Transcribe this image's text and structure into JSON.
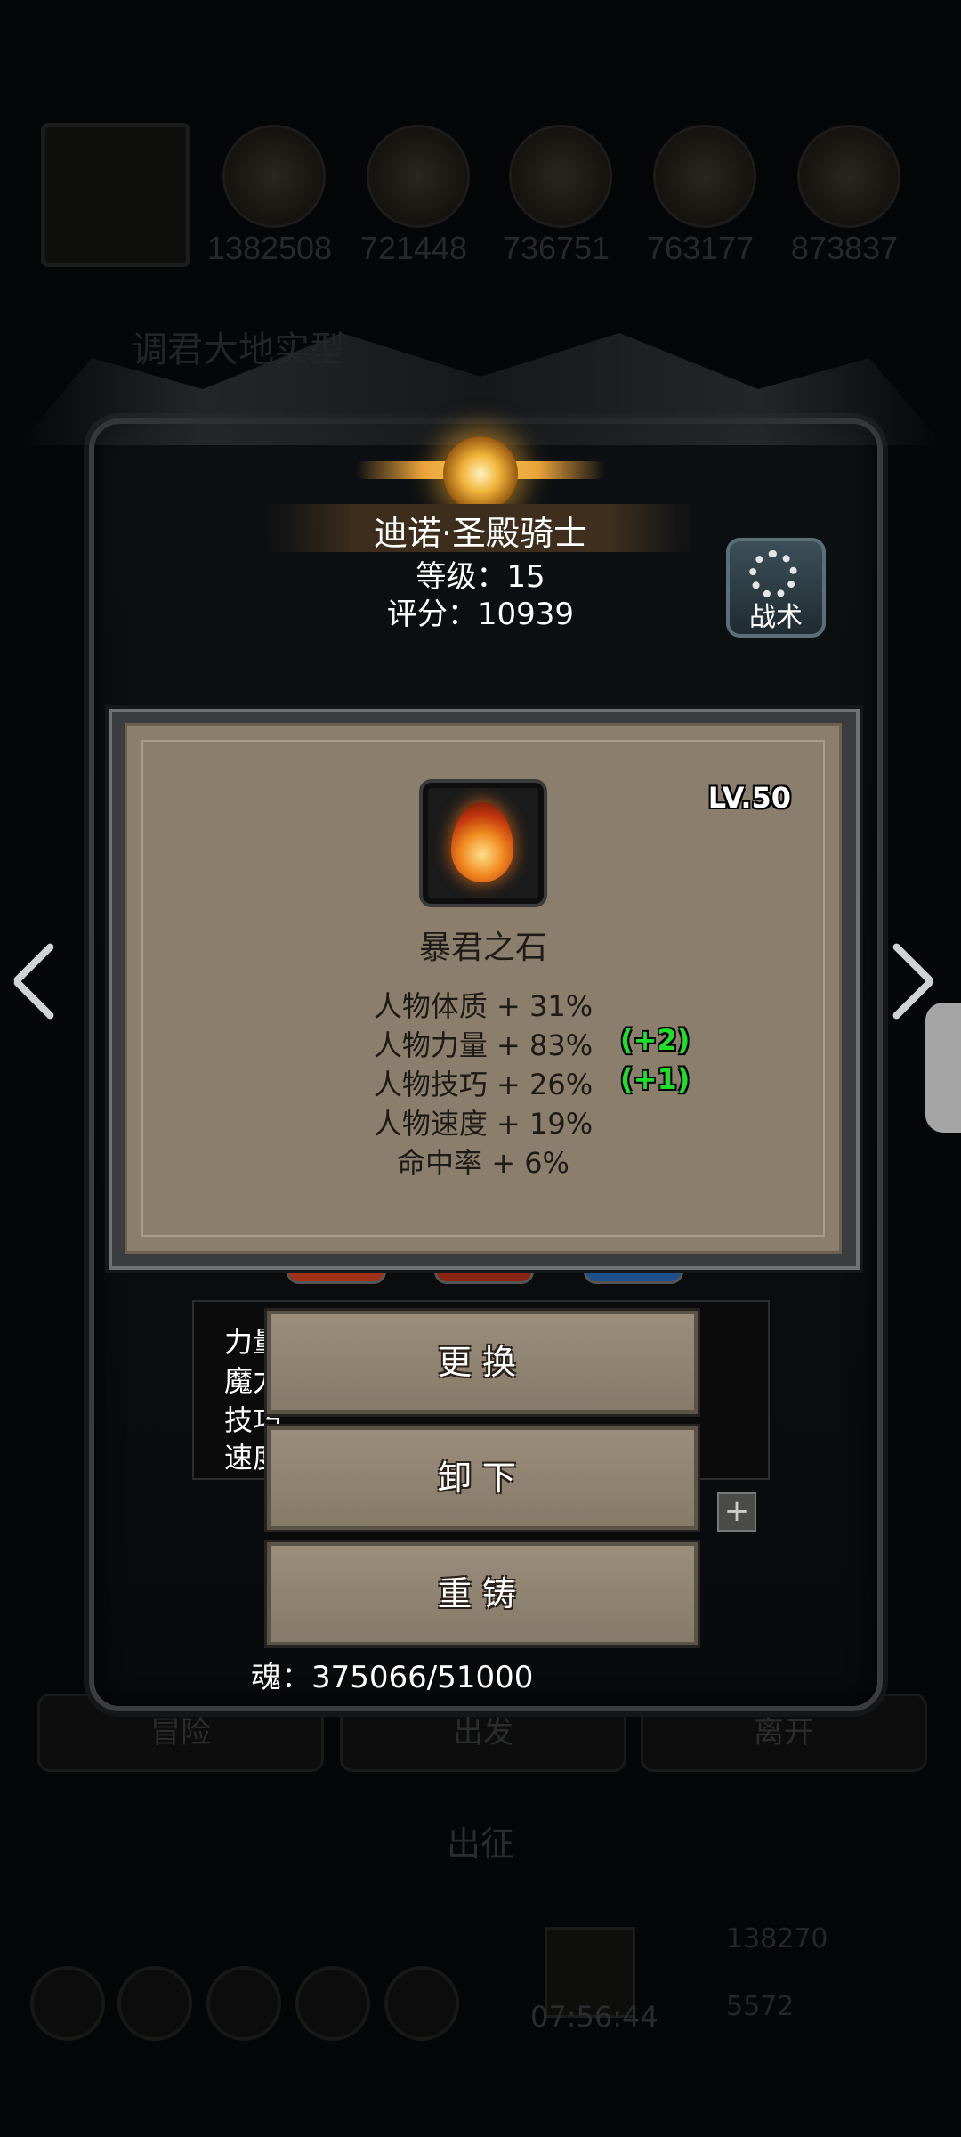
{
  "background": {
    "resources": [
      "1382508",
      "721448",
      "736751",
      "763177",
      "873837"
    ],
    "partial_title": "调君大地实型",
    "buttons": [
      "冒险",
      "出发",
      "离开"
    ],
    "center_label": "出征",
    "timer": "07:56:44",
    "coins": [
      "138270",
      "5572"
    ]
  },
  "hero": {
    "name": "迪诺·圣殿骑士",
    "level": "等级：15",
    "score": "评分：10939",
    "tactics_label": "战术",
    "hidden_stats": [
      "力量",
      "魔力",
      "技巧",
      "速度"
    ],
    "soul": "魂：375066/51000"
  },
  "item_card": {
    "level": "LV.50",
    "name": "暴君之石",
    "icon": "flame-gem-icon",
    "stats": [
      {
        "text": "人物体质 + 31%",
        "bonus": ""
      },
      {
        "text": "人物力量 + 83%",
        "bonus": "(+2)"
      },
      {
        "text": "人物技巧 + 26%",
        "bonus": "(+1)"
      },
      {
        "text": "人物速度 + 19%",
        "bonus": ""
      },
      {
        "text": "命中率 + 6%",
        "bonus": ""
      }
    ]
  },
  "actions": {
    "replace": "更换",
    "unequip": "卸下",
    "reforge": "重铸"
  },
  "colors": {
    "card_bg": "#8b7e6d",
    "bonus_green": "#1ee02a",
    "button_bg": "#918470"
  }
}
